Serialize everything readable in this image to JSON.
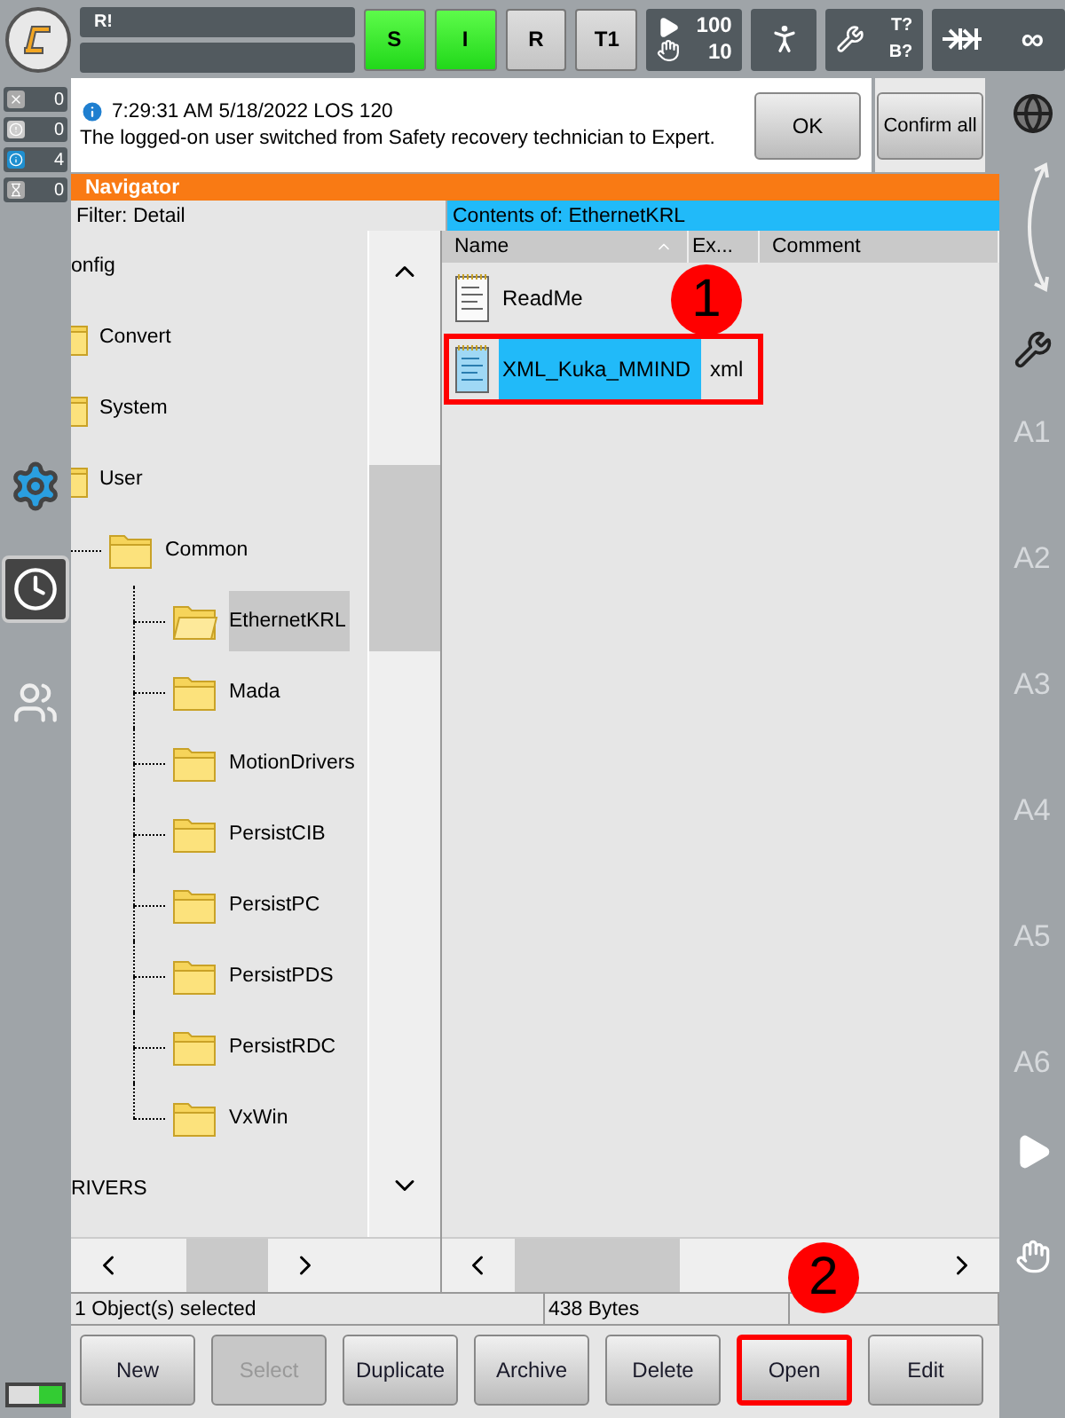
{
  "top_bar": {
    "robot_name": "R!",
    "status_buttons": [
      {
        "label": "S",
        "active": true
      },
      {
        "label": "I",
        "active": true
      },
      {
        "label": "R",
        "active": false
      },
      {
        "label": "T1",
        "active": false
      }
    ],
    "override": {
      "program": "100",
      "jog": "10"
    },
    "tool_base": {
      "tool": "T?",
      "base": "B?"
    },
    "increment": "∞"
  },
  "message_counters": [
    {
      "kind": "error",
      "count": "0"
    },
    {
      "kind": "warning",
      "count": "0"
    },
    {
      "kind": "info",
      "count": "4"
    },
    {
      "kind": "wait",
      "count": "0"
    }
  ],
  "message": {
    "time": "7:29:31 AM 5/18/2022 LOS 120",
    "text": "The logged-on user switched from Safety recovery technician to Expert.",
    "buttons": [
      "OK",
      "Confirm all"
    ]
  },
  "navigator": {
    "title": "Navigator",
    "filter": "Filter: Detail",
    "contents_title": "Contents of: EthernetKRL",
    "tree": [
      {
        "label": "onfig",
        "selected": false,
        "children": [
          {
            "label": "Convert",
            "selected": false
          },
          {
            "label": "System",
            "selected": false
          },
          {
            "label": "User",
            "selected": false,
            "children": [
              {
                "label": "Common",
                "selected": false,
                "children": [
                  {
                    "label": "EthernetKRL",
                    "selected": true
                  },
                  {
                    "label": "Mada",
                    "selected": false
                  },
                  {
                    "label": "MotionDrivers",
                    "selected": false
                  },
                  {
                    "label": "PersistCIB",
                    "selected": false
                  },
                  {
                    "label": "PersistPC",
                    "selected": false
                  },
                  {
                    "label": "PersistPDS",
                    "selected": false
                  },
                  {
                    "label": "PersistRDC",
                    "selected": false
                  },
                  {
                    "label": "VxWin",
                    "selected": false
                  }
                ]
              }
            ]
          }
        ]
      },
      {
        "label": "RIVERS",
        "selected": false
      }
    ],
    "columns": [
      "Name",
      "Ex...",
      "Comment"
    ],
    "files": [
      {
        "name": "ReadMe",
        "selected": false,
        "highlighted": false
      },
      {
        "name": "XML_Kuka_MMIND",
        "extension": "xml",
        "selected": true,
        "highlighted": true
      }
    ]
  },
  "status": [
    "1 Object(s) selected",
    "438 Bytes"
  ],
  "buttons": [
    {
      "label": "New",
      "disabled": false,
      "highlighted": false
    },
    {
      "label": "Select",
      "disabled": true,
      "highlighted": false
    },
    {
      "label": "Duplicate",
      "disabled": false,
      "highlighted": false
    },
    {
      "label": "Archive",
      "disabled": false,
      "highlighted": false
    },
    {
      "label": "Delete",
      "disabled": false,
      "highlighted": false
    },
    {
      "label": "Open",
      "disabled": false,
      "highlighted": true
    },
    {
      "label": "Edit",
      "disabled": false,
      "highlighted": false
    }
  ],
  "axes": [
    "A1",
    "A2",
    "A3",
    "A4",
    "A5",
    "A6"
  ],
  "annotations": [
    "1",
    "2"
  ]
}
